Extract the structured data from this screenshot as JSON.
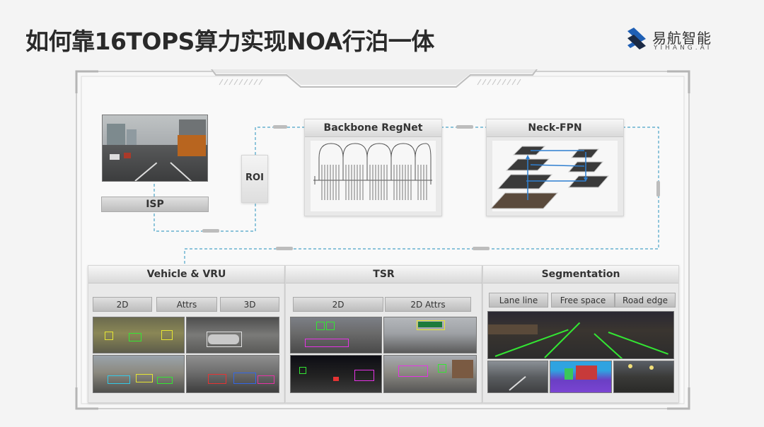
{
  "title": "如何靠16TOPS算力实现NOA行泊一体",
  "logo": {
    "cn": "易航智能",
    "en": "YIHANG.AI",
    "colors": {
      "blue": "#1f5fb4",
      "dark": "#1b2a44"
    }
  },
  "pipeline": {
    "isp": "ISP",
    "roi": "ROI",
    "backbone": "Backbone RegNet",
    "neck": "Neck-FPN"
  },
  "heads": {
    "vehicle": {
      "title": "Vehicle & VRU",
      "tags": [
        "2D",
        "Attrs",
        "3D"
      ]
    },
    "tsr": {
      "title": "TSR",
      "tags": [
        "2D",
        "2D Attrs"
      ]
    },
    "segmentation": {
      "title": "Segmentation",
      "tags": [
        "Lane line",
        "Free space",
        "Road edge"
      ]
    }
  },
  "colors": {
    "connector": "#4aa3c7",
    "frame": "#c8c8c8",
    "panel": "#e9e9e9"
  }
}
